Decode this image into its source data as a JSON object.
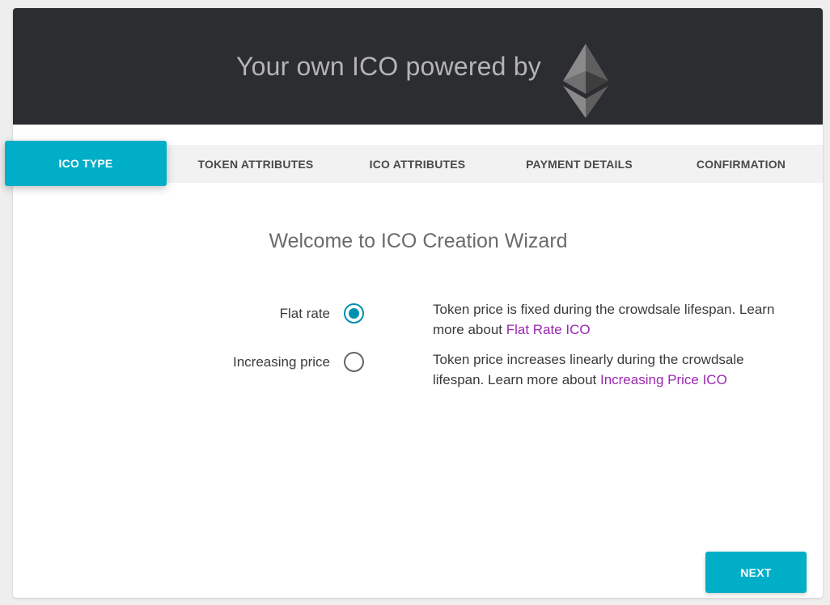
{
  "header": {
    "title": "Your own ICO powered by",
    "logo_icon": "ethereum-logo-icon"
  },
  "steps": [
    {
      "label": "ICO TYPE",
      "active": true
    },
    {
      "label": "TOKEN ATTRIBUTES",
      "active": false
    },
    {
      "label": "ICO ATTRIBUTES",
      "active": false
    },
    {
      "label": "PAYMENT DETAILS",
      "active": false
    },
    {
      "label": "CONFIRMATION",
      "active": false
    }
  ],
  "wizard": {
    "title": "Welcome to ICO Creation Wizard",
    "options": [
      {
        "label": "Flat rate",
        "selected": true,
        "description": "Token price is fixed during the crowdsale lifespan. Learn more about ",
        "link_text": "Flat Rate ICO"
      },
      {
        "label": "Increasing price",
        "selected": false,
        "description": "Token price increases linearly during the crowdsale lifespan. Learn more about ",
        "link_text": "Increasing Price ICO"
      }
    ]
  },
  "actions": {
    "next_label": "NEXT"
  },
  "colors": {
    "accent": "#00aec7",
    "header_bg": "#2b2d31",
    "link": "#9c27b0",
    "radio": "#0090b0"
  }
}
